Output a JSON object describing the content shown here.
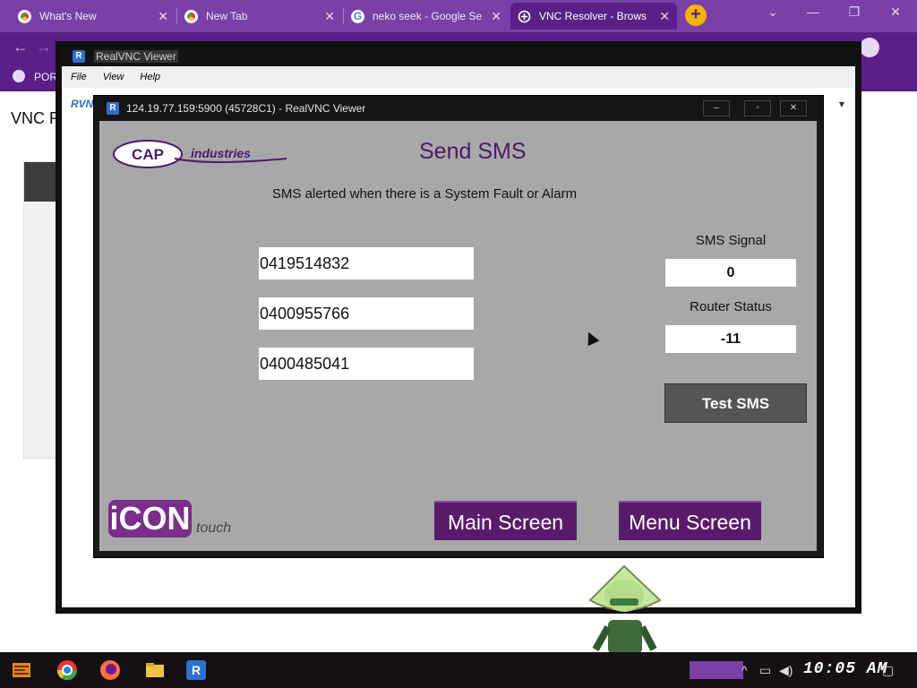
{
  "browser": {
    "tabs": [
      {
        "title": "What's New",
        "icon": "chrome-icon"
      },
      {
        "title": "New Tab",
        "icon": "chrome-icon"
      },
      {
        "title": "neko seek - Google Se",
        "icon": "google-icon"
      },
      {
        "title": "VNC Resolver - Brows",
        "icon": "vnc-icon"
      }
    ],
    "close_glyph": "✕",
    "new_tab_glyph": "+",
    "window_controls": {
      "chevron": "⌄",
      "minimize": "—",
      "restore": "❐",
      "close": "✕"
    },
    "bookmark_label": "POR",
    "page_heading": "VNC Re",
    "address_prefix": "RVNC"
  },
  "outer_window": {
    "title": "RealVNC Viewer",
    "menu": [
      "File",
      "View",
      "Help"
    ]
  },
  "inner_window": {
    "title": "124.19.77.159:5900 (45728C1) - RealVNC Viewer",
    "controls": {
      "minimize": "–",
      "maximize": "▫",
      "close": "✕"
    }
  },
  "hmi": {
    "logo_text": "CAP",
    "logo_suffix": "industries",
    "title": "Send SMS",
    "subtitle": "SMS alerted when there is a System Fault or Alarm",
    "phone_numbers": [
      "0419514832",
      "0400955766",
      "0400485041"
    ],
    "sms_signal_label": "SMS Signal",
    "sms_signal_value": "0",
    "router_status_label": "Router Status",
    "router_status_value": "-11",
    "test_sms_label": "Test SMS",
    "main_screen_label": "Main Screen",
    "menu_screen_label": "Menu Screen",
    "brand_logo": "iCON",
    "brand_suffix": "touch"
  },
  "taskbar": {
    "clock": "10:05 AM",
    "tray_icons": [
      "chevron-up-icon",
      "network-icon",
      "volume-icon",
      "notification-icon"
    ]
  },
  "colors": {
    "browser_purple": "#7b3fa8",
    "hmi_gray": "#a8a8a8",
    "hmi_title_purple": "#4a1a6b",
    "nav_button_purple": "#5a1a6b"
  }
}
